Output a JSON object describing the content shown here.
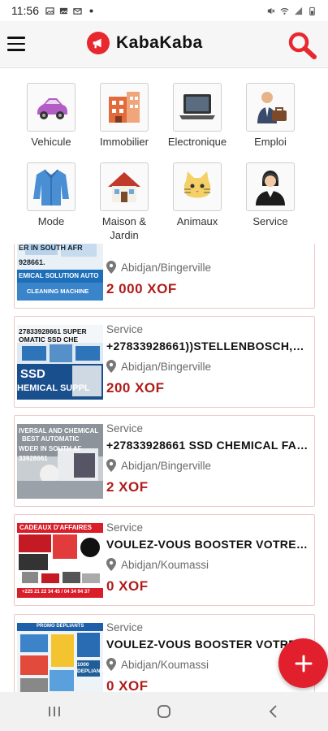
{
  "status_bar": {
    "time": "11:56",
    "left_icons": [
      "image-icon",
      "image-icon",
      "mail-icon",
      "dot-icon"
    ],
    "right_icons": [
      "mute-icon",
      "wifi-icon",
      "signal-icon",
      "battery-icon"
    ]
  },
  "app_bar": {
    "title": "KabaKaba",
    "accent": "#e8272f"
  },
  "categories": [
    {
      "label": "Vehicule",
      "icon": "car-icon"
    },
    {
      "label": "Immobilier",
      "icon": "building-icon"
    },
    {
      "label": "Electronique",
      "icon": "laptop-icon"
    },
    {
      "label": "Emploi",
      "icon": "briefcase-icon"
    },
    {
      "label": "Mode",
      "icon": "jacket-icon"
    },
    {
      "label": "Maison & Jardin",
      "icon": "house-icon"
    },
    {
      "label": "Animaux",
      "icon": "cat-icon"
    },
    {
      "label": "Service",
      "icon": "agent-icon"
    }
  ],
  "listings": [
    {
      "category": "",
      "title": "",
      "location": "Abidjan/Bingerville",
      "price": "2 000  XOF",
      "thumb_text": [
        "ER IN SOUTH AFR",
        "928661.",
        "EMICAL SOLUTION AUTO",
        "CLEANING MACHINE"
      ]
    },
    {
      "category": "Service",
      "title": "+27833928661))STELLENBOSCH,VI...",
      "location": "Abidjan/Bingerville",
      "price": "200  XOF",
      "thumb_text": [
        "27833928661 SUPER",
        "OMATIC SSD CHE",
        "SSD",
        "HEMICAL SUPPL"
      ]
    },
    {
      "category": "Service",
      "title": "+27833928661 SSD CHEMICAL FAC...",
      "location": "Abidjan/Bingerville",
      "price": "2  XOF",
      "thumb_text": [
        "IVERSAL AND CHEMICAL",
        "BEST AUTOMATIC",
        "WDER IN SOUTH AF",
        "33928661"
      ]
    },
    {
      "category": "Service",
      "title": "VOULEZ-VOUS BOOSTER VOTRE VIS...",
      "location": "Abidjan/Koumassi",
      "price": "0  XOF",
      "thumb_text": [
        "CADEAUX D'AFFAIRES",
        "+225 21 22 34 45 / 04 34 94 37"
      ]
    },
    {
      "category": "Service",
      "title": "VOULEZ-VOUS BOOSTER VOTRE V...",
      "location": "Abidjan/Koumassi",
      "price": "0  XOF",
      "thumb_text": [
        "PROMO DEPLIANTS",
        "1000 DEPLIANTS"
      ]
    }
  ],
  "colors": {
    "price": "#b01c1c",
    "fab": "#e11f2d",
    "card_border": "#f0c9c9"
  }
}
